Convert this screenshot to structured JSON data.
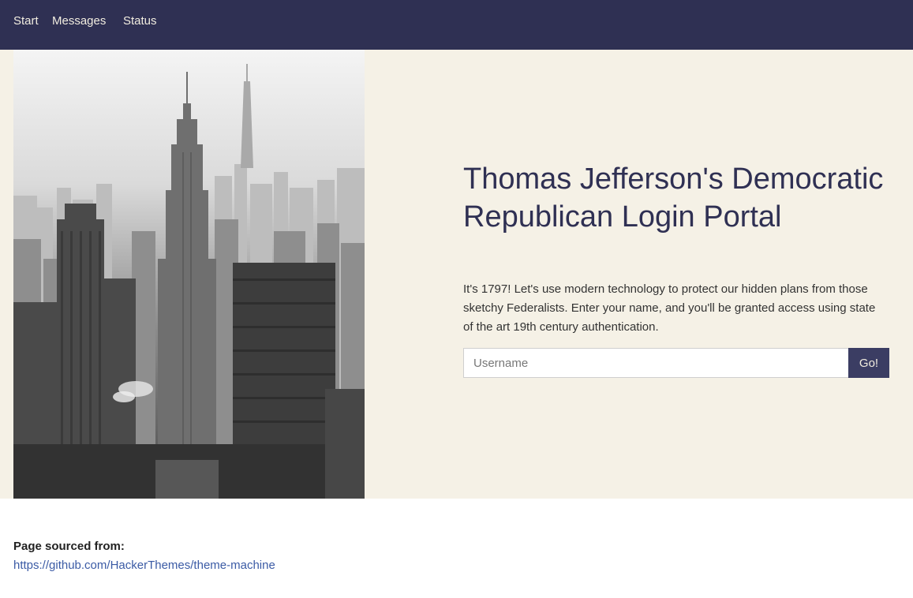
{
  "nav": {
    "items": [
      {
        "label": "Start"
      },
      {
        "label": "Messages"
      },
      {
        "label": "Status"
      }
    ]
  },
  "hero": {
    "image_alt": "city-skyline-photo",
    "title": "Thomas Jefferson's Democratic Republican Login Portal",
    "description": "It's 1797! Let's use modern technology to protect our hidden plans from those sketchy Federalists. Enter your name, and you'll be granted access using state of the art 19th century authentication.",
    "form": {
      "username_placeholder": "Username",
      "username_value": "",
      "submit_label": "Go!"
    }
  },
  "footer": {
    "source_label": "Page sourced from:",
    "source_link": "https://github.com/HackerThemes/theme-machine"
  },
  "colors": {
    "navbar_bg": "#2f3053",
    "hero_bg": "#f5f1e6",
    "title_color": "#2f3053",
    "button_bg": "#3b3d63",
    "link_color": "#3b5ba5"
  }
}
